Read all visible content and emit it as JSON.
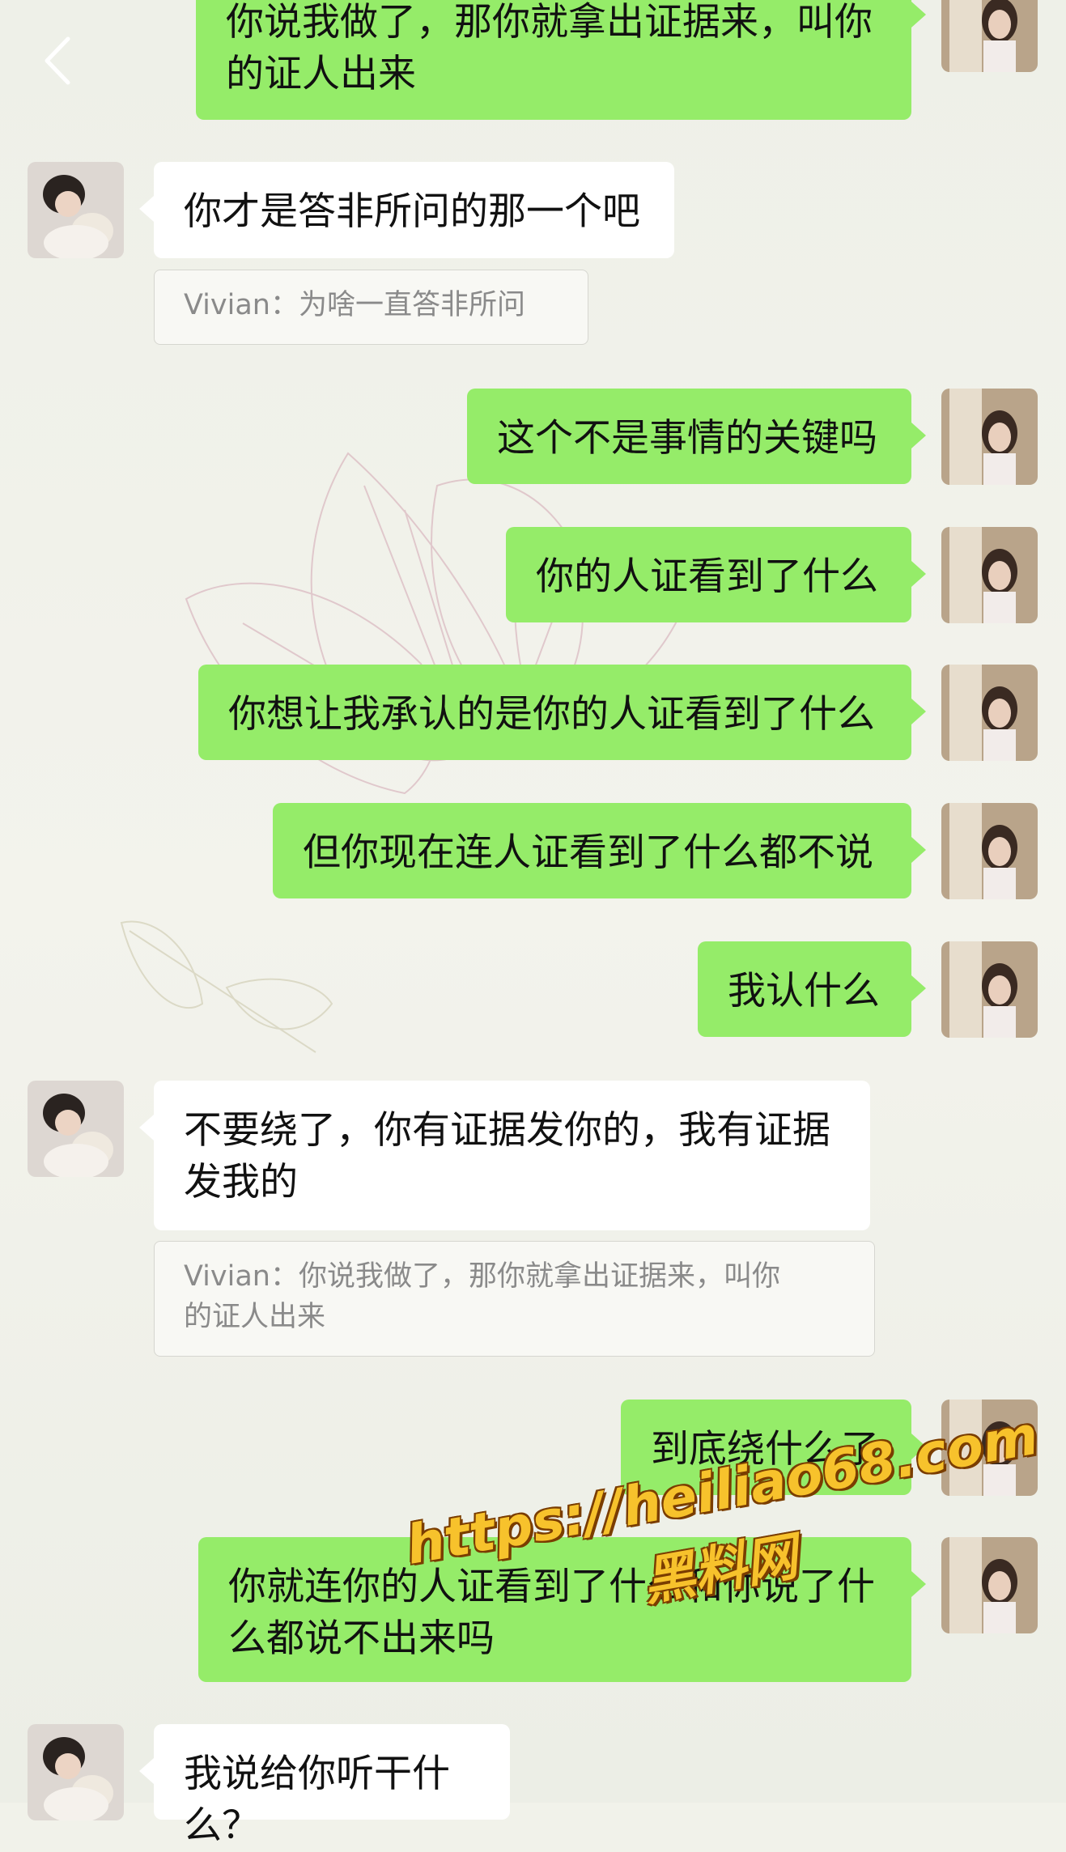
{
  "colors": {
    "mine_bubble": "#95ec69",
    "theirs_bubble": "#ffffff",
    "background": "#f1f2ea",
    "watermark": "#f7c22c"
  },
  "header": {
    "back_icon": "chevron-left-icon"
  },
  "messages": [
    {
      "side": "mine",
      "text": "你说我做了，那你就拿出证据来，叫你\n的证人出来"
    },
    {
      "side": "theirs",
      "text": "你才是答非所问的那一个吧",
      "quote": "Vivian：为啥一直答非所问"
    },
    {
      "side": "mine",
      "text": "这个不是事情的关键吗"
    },
    {
      "side": "mine",
      "text": "你的人证看到了什么"
    },
    {
      "side": "mine",
      "text": "你想让我承认的是你的人证看到了什么"
    },
    {
      "side": "mine",
      "text": "但你现在连人证看到了什么都不说"
    },
    {
      "side": "mine",
      "text": "我认什么"
    },
    {
      "side": "theirs",
      "text": "不要绕了，你有证据发你的，我有证据\n发我的",
      "quote": "Vivian：你说我做了，那你就拿出证据来，叫你\n的证人出来"
    },
    {
      "side": "mine",
      "text": "到底绕什么了"
    },
    {
      "side": "mine",
      "text": "你就连你的人证看到了什么和你说了什\n么都说不出来吗"
    },
    {
      "side": "theirs",
      "text": "我说给你听干什么？"
    }
  ],
  "watermark": {
    "url": "https://heiliao68.com",
    "site": "黑料网"
  }
}
